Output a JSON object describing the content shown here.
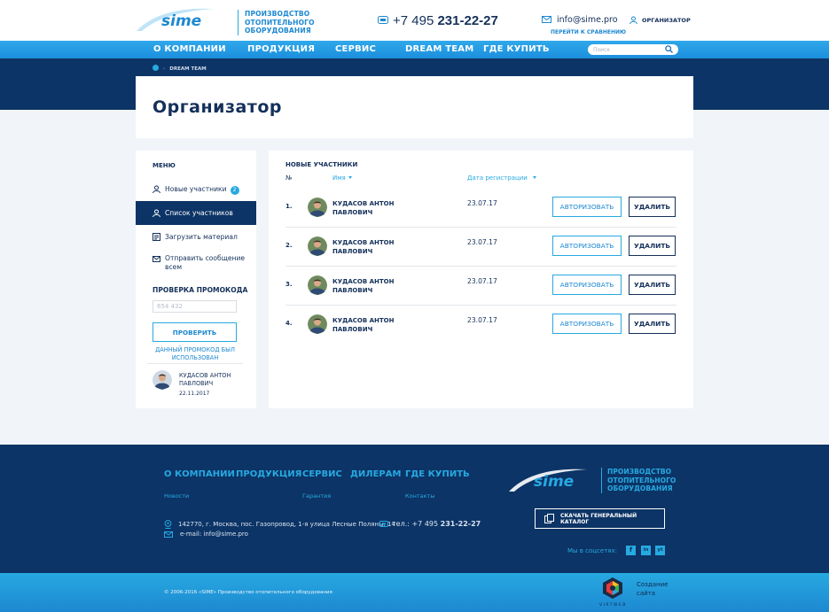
{
  "header": {
    "logo_text": "sime",
    "tagline": [
      "Производство",
      "отопительного",
      "оборудования"
    ],
    "phone_prefix": "+7 495",
    "phone_main": "231-22-27",
    "email": "info@sime.pro",
    "compare_link": "Перейти к сравнению",
    "user_label": "Организатор"
  },
  "nav": {
    "items": [
      "О компании",
      "Продукция",
      "Сервис",
      "Dream team",
      "Где купить"
    ],
    "search_placeholder": "Поиск"
  },
  "breadcrumb": {
    "current": "Dream team"
  },
  "page_title": "Организатор",
  "sidebar": {
    "heading": "МЕНЮ",
    "items": [
      {
        "label": "Новые участники",
        "badge": "2",
        "icon": "user-icon"
      },
      {
        "label": "Список участников",
        "icon": "user-icon"
      },
      {
        "label": "Загрузить материал",
        "icon": "upload-icon"
      },
      {
        "label": "Отправить сообщение всем",
        "icon": "mail-icon"
      }
    ],
    "promo_heading": "ПРОВЕРКА ПРОМОКОДА",
    "promo_value": "654 432",
    "promo_button": "Проверить",
    "promo_used": "Данный промокод был использован",
    "promo_user_name": "Кудасов Антон Павлович",
    "promo_user_date": "22.11.2017"
  },
  "main": {
    "heading": "Новые участники",
    "columns": {
      "num": "№",
      "name": "Имя",
      "date": "Дата регистрации"
    },
    "rows": [
      {
        "n": "1.",
        "name": "Кудасов Антон Павлович",
        "date": "23.07.17"
      },
      {
        "n": "2.",
        "name": "Кудасов Антон Павлович",
        "date": "23.07.17"
      },
      {
        "n": "3.",
        "name": "Кудасов Антон Павлович",
        "date": "23.07.17"
      },
      {
        "n": "4.",
        "name": "Кудасов Антон Павлович",
        "date": "23.07.17"
      }
    ],
    "authorize_label": "Авторизовать",
    "delete_label": "Удалить"
  },
  "footer": {
    "nav": [
      "О компании",
      "Продукция",
      "Сервис",
      "Дилерам",
      "Где купить"
    ],
    "sub": [
      "Новости",
      "Гарантия",
      "Контакты"
    ],
    "address": "142770, г. Москва, пос. Газопровод, 1-я улица Лесные Поляны, 14",
    "email_line": "e-mail: info@sime.pro",
    "phone_prefix": "тел.: +7 495",
    "phone_main": "231-22-27",
    "logo_text": "sime",
    "tagline": [
      "Производство",
      "отопительного",
      "оборудования"
    ],
    "catalog_button": "Скачать генеральный каталог",
    "social_label": "Мы в соцсетях:",
    "social": [
      "f",
      "in",
      "yt"
    ],
    "copyright": "© 2006-2016 «SIME» Производство отопительного оборудования",
    "made_by": [
      "Создание",
      "сайта"
    ],
    "made_brand": "VIRTWEB"
  },
  "colors": {
    "navy": "#0c3466",
    "accent": "#27a9e1",
    "text": "#14305a"
  }
}
